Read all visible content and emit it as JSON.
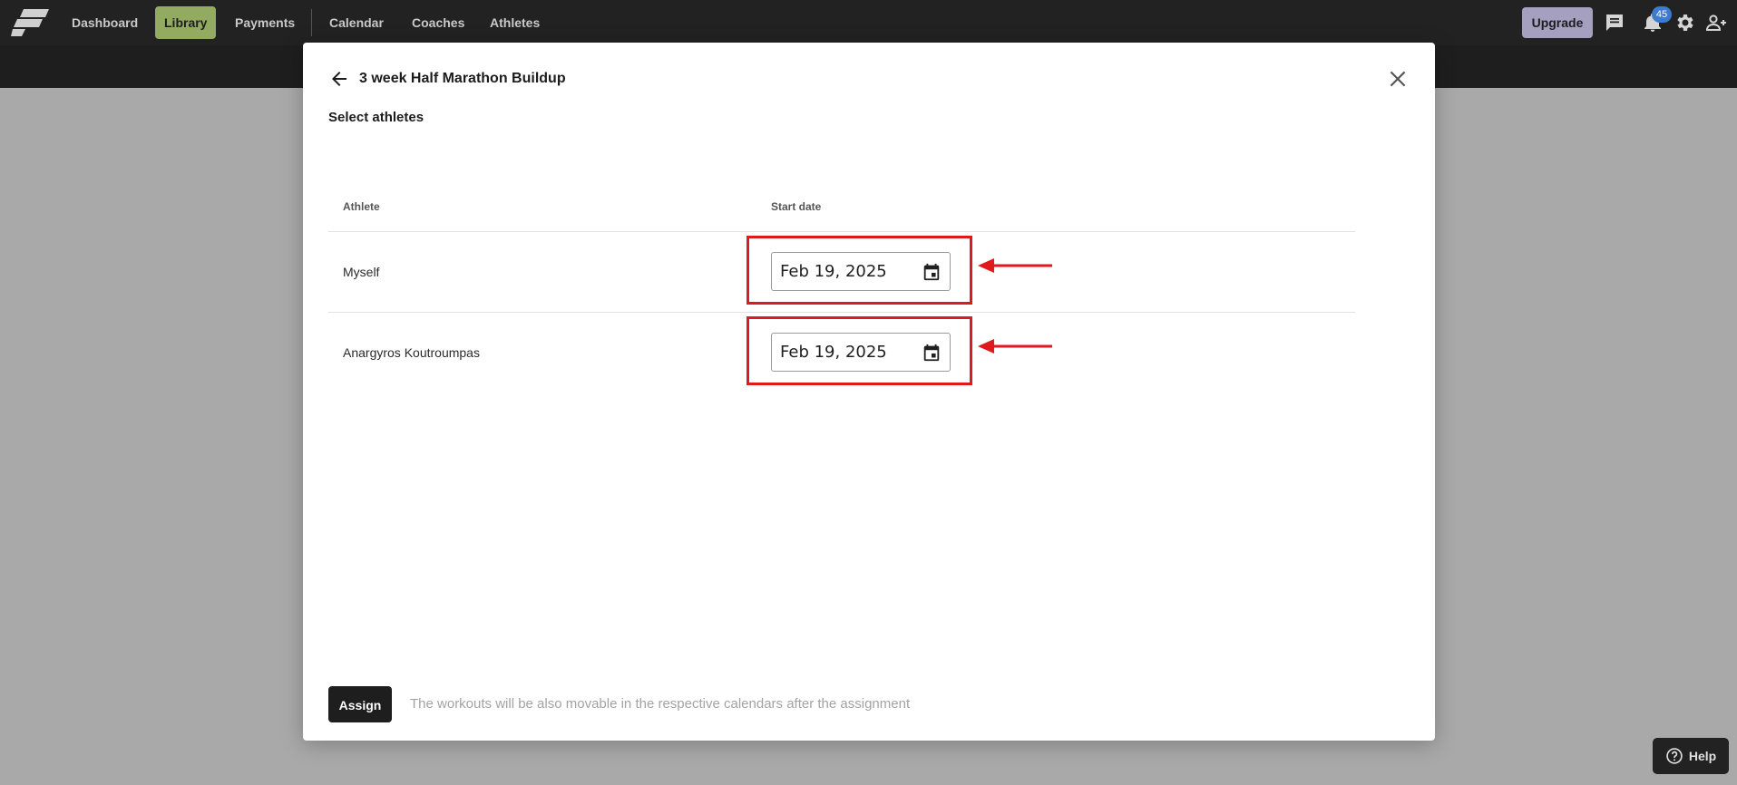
{
  "nav": {
    "items": [
      {
        "label": "Dashboard",
        "active": false
      },
      {
        "label": "Library",
        "active": true
      },
      {
        "label": "Payments",
        "active": false
      },
      {
        "label": "Calendar",
        "active": false
      },
      {
        "label": "Coaches",
        "active": false
      },
      {
        "label": "Athletes",
        "active": false
      }
    ],
    "upgrade_label": "Upgrade",
    "notification_count": "45",
    "icons": [
      "chat-icon",
      "bell-icon",
      "gear-icon",
      "add-person-icon"
    ],
    "active_color": "#93ab61",
    "upgrade_color": "#a59fc0"
  },
  "modal": {
    "title": "3 week Half Marathon Buildup",
    "section_title": "Select athletes",
    "columns": {
      "athlete": "Athlete",
      "start_date": "Start date"
    },
    "rows": [
      {
        "athlete": "Myself",
        "start_date": "Feb 19, 2025"
      },
      {
        "athlete": "Anargyros Koutroumpas",
        "start_date": "Feb 19, 2025"
      }
    ],
    "assign_label": "Assign",
    "assign_note": "The workouts will be also movable in the respective calendars after the assignment",
    "highlight_color": "#e0191d"
  },
  "help": {
    "label": "Help"
  }
}
